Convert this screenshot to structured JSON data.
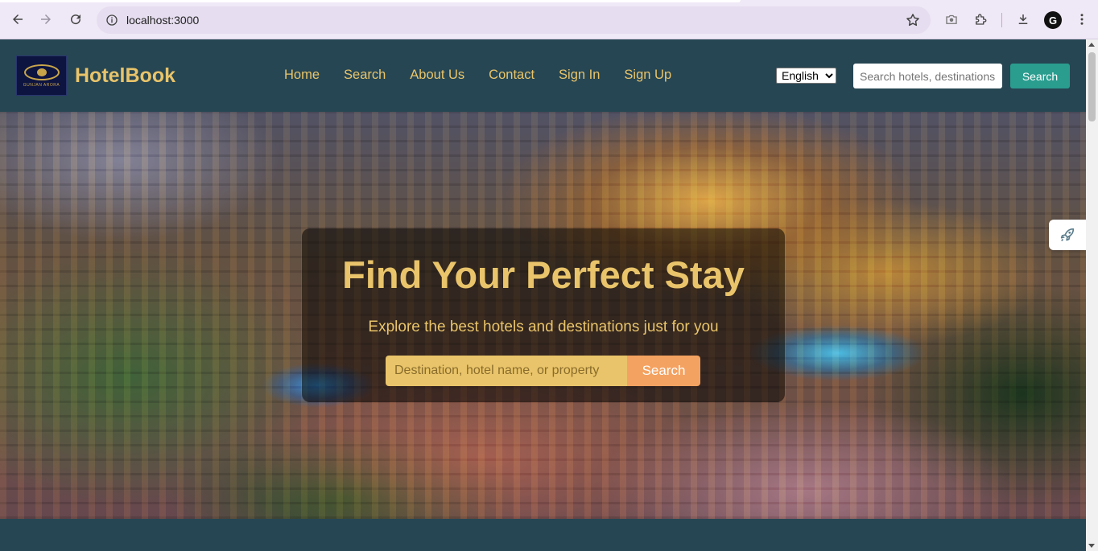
{
  "browser": {
    "url": "localhost:3000",
    "icons": [
      "back-arrow-icon",
      "forward-arrow-icon",
      "reload-icon",
      "site-info-icon",
      "bookmark-star-icon",
      "camera-icon",
      "extensions-icon",
      "download-icon",
      "profile-avatar-icon",
      "more-menu-icon"
    ],
    "profile_initial": "G"
  },
  "navbar": {
    "logo_caption": "GUNJAN ARORA",
    "brand": "HotelBook",
    "links": [
      "Home",
      "Search",
      "About Us",
      "Contact",
      "Sign In",
      "Sign Up"
    ],
    "language": {
      "selected": "English",
      "options": [
        "English"
      ]
    },
    "search": {
      "placeholder": "Search hotels, destinations...",
      "button": "Search"
    }
  },
  "hero": {
    "title": "Find Your Perfect Stay",
    "subtitle": "Explore the best hotels and destinations just for you",
    "search": {
      "placeholder": "Destination, hotel name, or property",
      "button": "Search"
    }
  },
  "colors": {
    "primary": "#264653",
    "accent_gold": "#e9c46a",
    "teal": "#2a9d8f",
    "orange": "#f4a261"
  }
}
